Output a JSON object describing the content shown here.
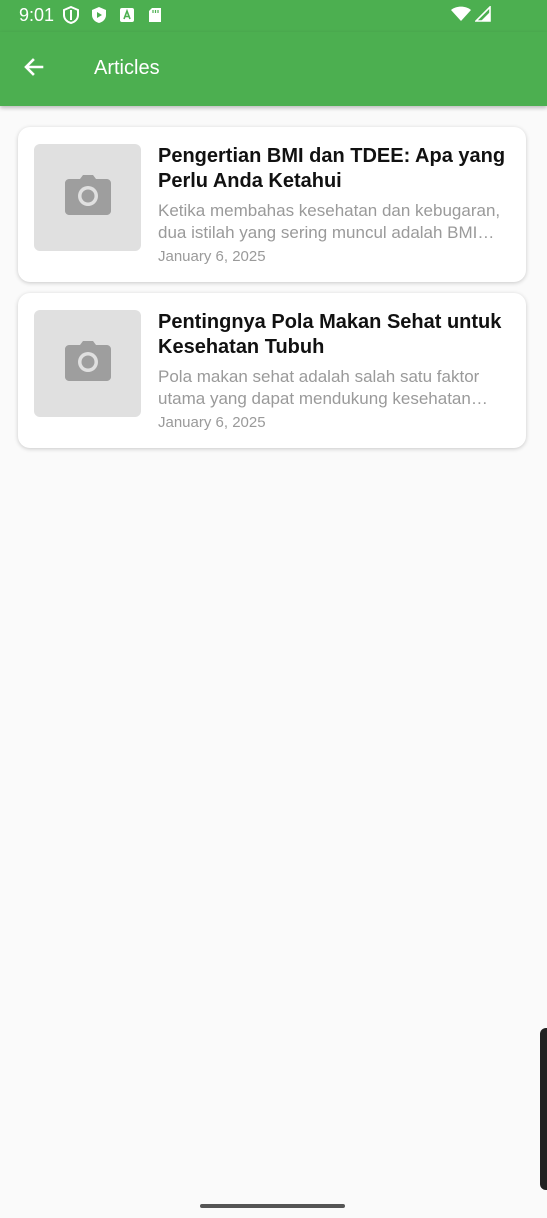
{
  "status_bar": {
    "time": "9:01",
    "icons": [
      "shield-icon",
      "play-protect-icon",
      "a-badge-icon",
      "sd-card-icon"
    ],
    "right_icons": [
      "wifi-icon",
      "cell-signal-icon"
    ]
  },
  "app_bar": {
    "title": "Articles",
    "back_icon": "arrow-back-icon",
    "color": "#4caf50"
  },
  "articles": [
    {
      "title": "Pengertian BMI dan TDEE: Apa yang Perlu Anda Ketahui",
      "excerpt": "Ketika membahas kesehatan dan kebugaran, dua istilah yang sering muncul adalah BMI dan TDEE",
      "date": "January 6, 2025",
      "image_icon": "camera-icon"
    },
    {
      "title": "Pentingnya Pola Makan Sehat untuk Kesehatan Tubuh",
      "excerpt": "Pola makan sehat adalah salah satu faktor utama yang dapat mendukung kesehatan tubuh",
      "date": "January 6, 2025",
      "image_icon": "camera-icon"
    }
  ]
}
